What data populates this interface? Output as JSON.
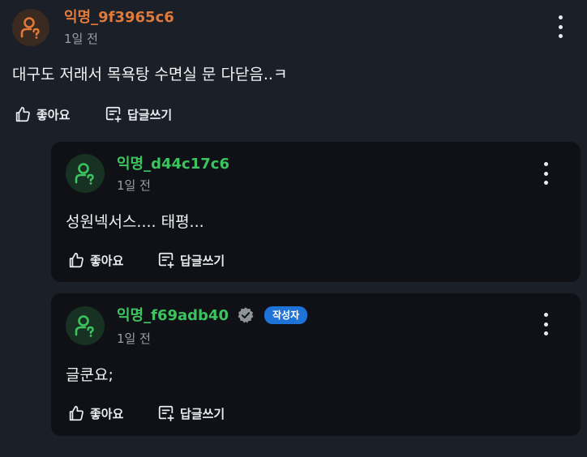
{
  "post": {
    "username": "익명_9f3965c6",
    "time": "1일 전",
    "text": "대구도 저래서 목욕탕 수면실 문 다닫음..ㅋ",
    "like_label": "좋아요",
    "reply_label": "답글쓰기",
    "accent_color": "#e07a3a"
  },
  "replies": [
    {
      "username": "익명_d44c17c6",
      "time": "1일 전",
      "text": "성원넥서스.... 태평...",
      "like_label": "좋아요",
      "reply_label": "답글쓰기",
      "accent_color": "#3cc45f"
    },
    {
      "username": "익명_f69adb40",
      "time": "1일 전",
      "text": "글쿤요;",
      "author_badge": "작성자",
      "like_label": "좋아요",
      "reply_label": "답글쓰기",
      "accent_color": "#3cc45f",
      "badge_color": "#1d73d6"
    }
  ],
  "icons": {
    "avatar": "anonymous-user-icon",
    "like": "thumbs-up-icon",
    "reply": "reply-comment-icon",
    "more": "kebab-menu-icon",
    "verified": "verified-badge-icon"
  }
}
